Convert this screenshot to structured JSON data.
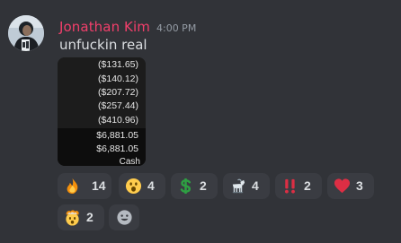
{
  "message": {
    "author": "Jonathan Kim",
    "timestamp": "4:00 PM",
    "text": "unfuckin real",
    "author_color": "#f23f6b"
  },
  "attachment": {
    "values": [
      "($131.65)",
      "($140.12)",
      "($207.72)",
      "($257.44)",
      "($410.96)",
      "$6,881.05",
      "$6,881.05"
    ],
    "footer_label": "Cash"
  },
  "reactions": [
    {
      "emoji": "fire-emoji",
      "count": "14"
    },
    {
      "emoji": "open-mouth-emoji",
      "count": "4"
    },
    {
      "emoji": "dollar-sign-emoji",
      "count": "2"
    },
    {
      "emoji": "goat-emoji",
      "count": "4"
    },
    {
      "emoji": "double-exclamation-emoji",
      "count": "2"
    },
    {
      "emoji": "red-heart-emoji",
      "count": "3"
    },
    {
      "emoji": "exploding-head-emoji",
      "count": "2"
    }
  ],
  "add_reaction_icon": "add-reaction-smiley-icon"
}
